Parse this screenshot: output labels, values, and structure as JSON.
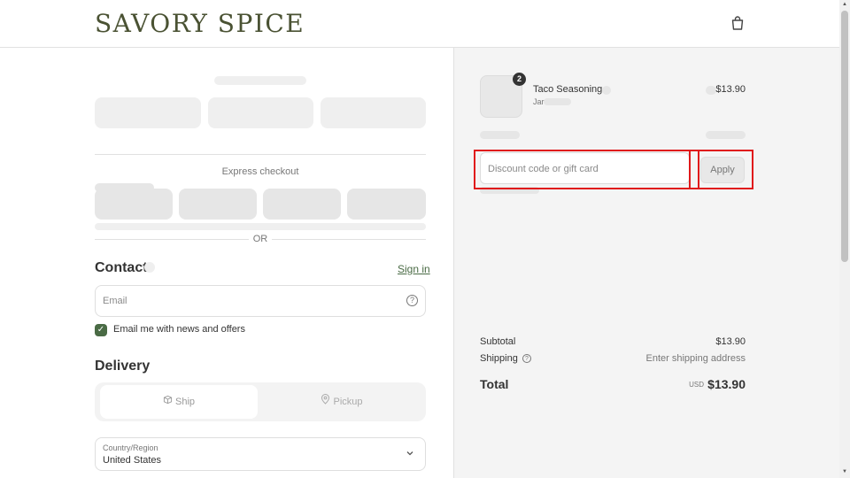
{
  "header": {
    "logo": "SAVORY SPICE",
    "cart_icon": "shopping-bag-icon"
  },
  "checkout": {
    "express_label": "Express checkout",
    "or_label": "OR",
    "contact": {
      "title": "Contact",
      "signin_label": "Sign in",
      "email_placeholder": "Email",
      "news_label": "Email me with news and offers",
      "news_checked": true
    },
    "delivery": {
      "title": "Delivery",
      "tabs": [
        {
          "label": "Ship",
          "icon": "package-icon"
        },
        {
          "label": "Pickup",
          "icon": "location-pin-icon"
        }
      ],
      "country_label": "Country/Region",
      "country_value": "United States"
    }
  },
  "summary": {
    "product": {
      "name": "Taco Seasoning",
      "variant": "Jar",
      "quantity": "2",
      "price": "$13.90"
    },
    "discount_placeholder": "Discount code or gift card",
    "apply_label": "Apply",
    "subtotal_label": "Subtotal",
    "subtotal_value": "$13.90",
    "shipping_label": "Shipping",
    "shipping_value": "Enter shipping address",
    "total_label": "Total",
    "currency": "USD",
    "total_value": "$13.90"
  },
  "colors": {
    "brand": "#4a5233",
    "accent": "#4a6b45",
    "highlight": "#e0191b"
  }
}
